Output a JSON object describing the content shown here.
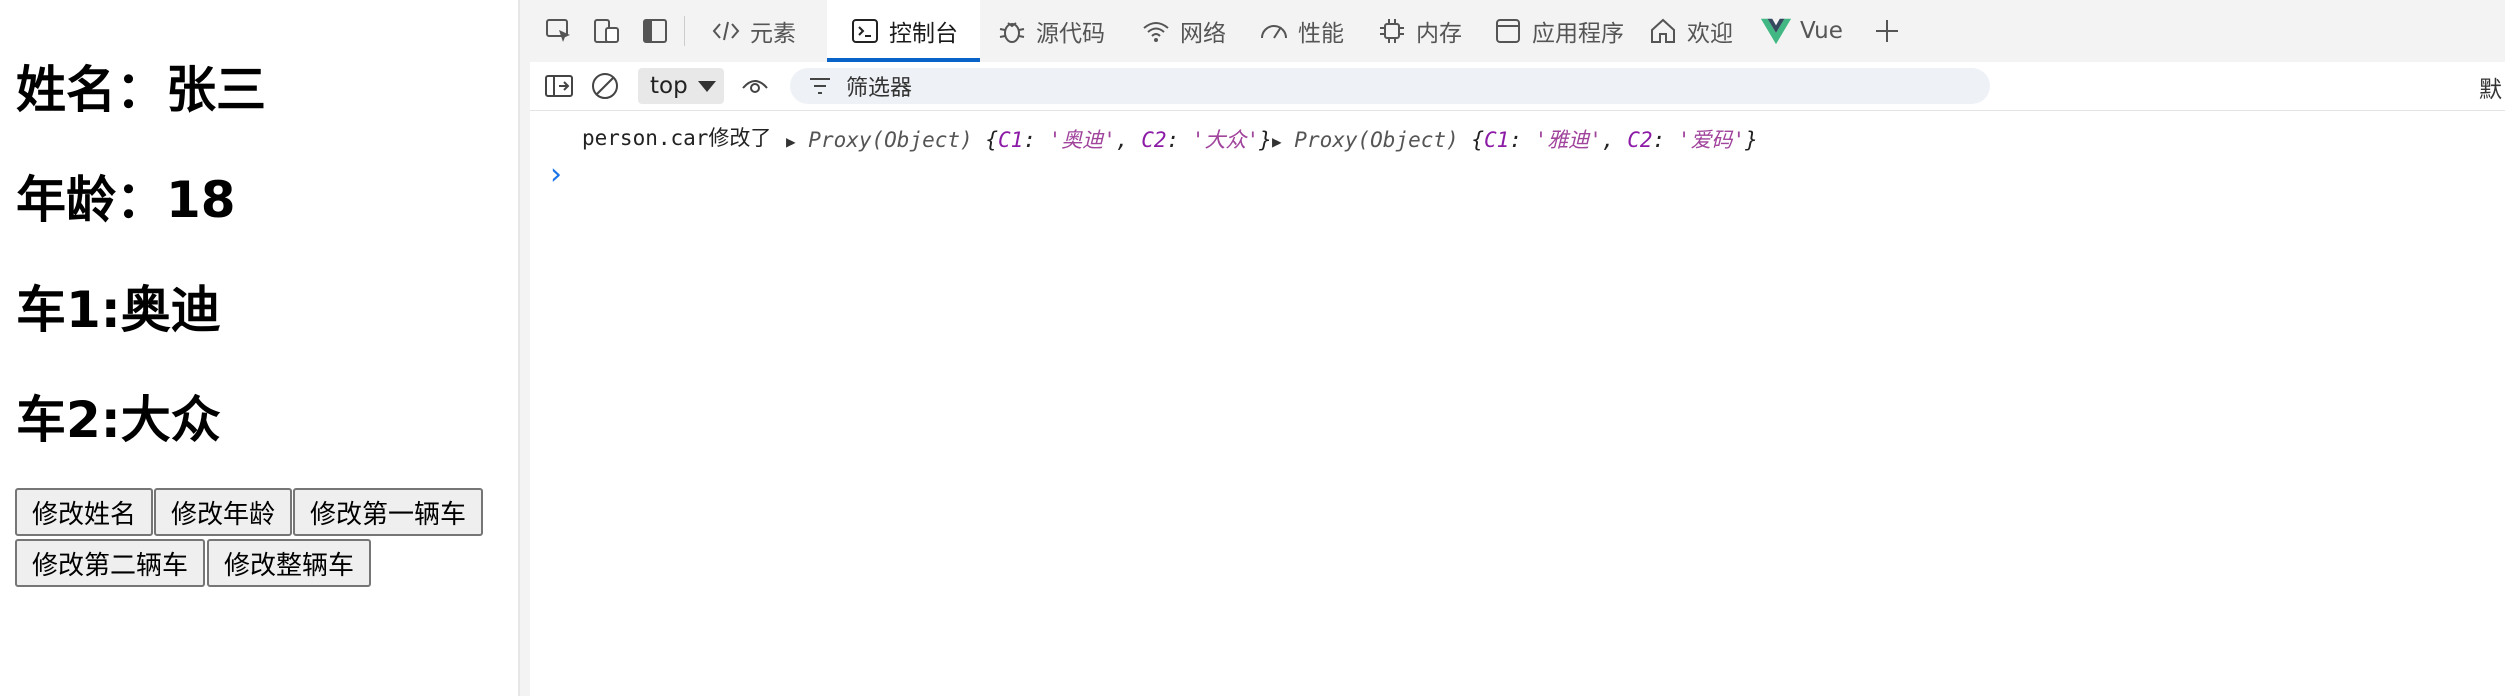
{
  "app": {
    "name_line": "姓名：张三",
    "age_line": "年龄：18",
    "car1_line": "车1:奥迪",
    "car2_line": "车2:大众",
    "buttons": {
      "edit_name": "修改姓名",
      "edit_age": "修改年龄",
      "edit_car1": "修改第一辆车",
      "edit_car2": "修改第二辆车",
      "edit_whole_car": "修改整辆车"
    }
  },
  "devtools": {
    "tabs": [
      {
        "label": "元素",
        "icon": "code-tag-icon"
      },
      {
        "label": "控制台",
        "icon": "console-icon"
      },
      {
        "label": "源代码",
        "icon": "bug-icon"
      },
      {
        "label": "网络",
        "icon": "wifi-icon"
      },
      {
        "label": "性能",
        "icon": "gauge-icon"
      },
      {
        "label": "内存",
        "icon": "chip-icon"
      },
      {
        "label": "应用程序",
        "icon": "app-window-icon"
      },
      {
        "label": "欢迎",
        "icon": "home-icon"
      },
      {
        "label": "Vue",
        "icon": "vue-logo-icon"
      }
    ],
    "active_tab": "控制台",
    "console": {
      "context": "top",
      "filter_placeholder": "筛选器",
      "default_levels": "默",
      "log": {
        "message": "person.car修改了",
        "new_value": {
          "type": "Proxy(Object)",
          "C1_key": "C1",
          "C1_val": "奥迪",
          "C2_key": "C2",
          "C2_val": "大众"
        },
        "old_value": {
          "type": "Proxy(Object)",
          "C1_key": "C1",
          "C1_val": "雅迪",
          "C2_key": "C2",
          "C2_val": "爱码"
        }
      },
      "prompt": "›"
    },
    "accent": "#0a64c8"
  }
}
